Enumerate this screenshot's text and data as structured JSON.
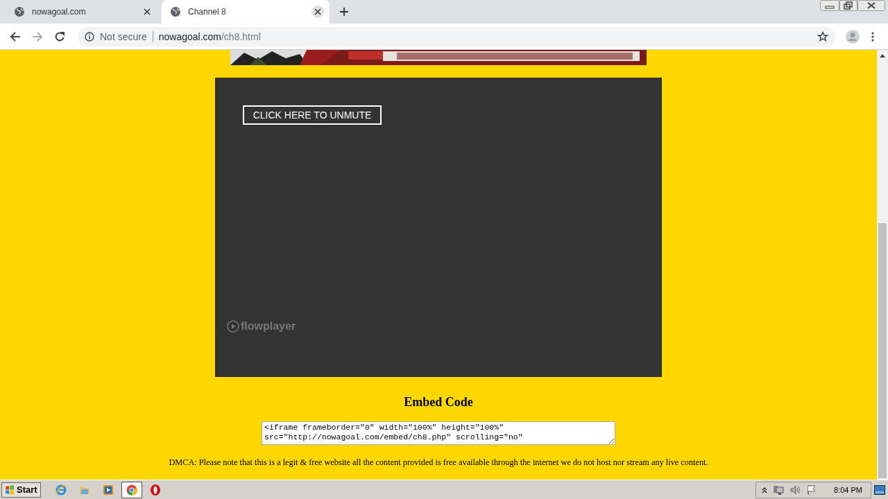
{
  "browser": {
    "tabs": [
      {
        "title": "nowagoal.com",
        "selected": false
      },
      {
        "title": "Channel 8",
        "selected": true
      }
    ],
    "address": {
      "security": "Not secure",
      "host": "nowagoal.com",
      "path": "/ch8.html"
    }
  },
  "page": {
    "player": {
      "unmute_button": "CLICK HERE TO UNMUTE",
      "brand": "flowplayer"
    },
    "embed_heading": "Embed Code",
    "embed_code": "<iframe frameborder=\"0\" width=\"100%\" height=\"100%\" src=\"http://nowagoal.com/embed/ch8.php\" scrolling=\"no\"",
    "dmca": "DMCA: Please note that this is a legit & free website all the content provided is free available through the internet we do not host nor stream any live content."
  },
  "taskbar": {
    "start": "Start",
    "apps": [
      {
        "kind": "ie",
        "selected": false
      },
      {
        "kind": "explorer",
        "selected": false
      },
      {
        "kind": "media",
        "selected": false
      },
      {
        "kind": "chrome",
        "selected": true
      },
      {
        "kind": "opera",
        "selected": false
      }
    ],
    "clock": "8:04 PM"
  }
}
